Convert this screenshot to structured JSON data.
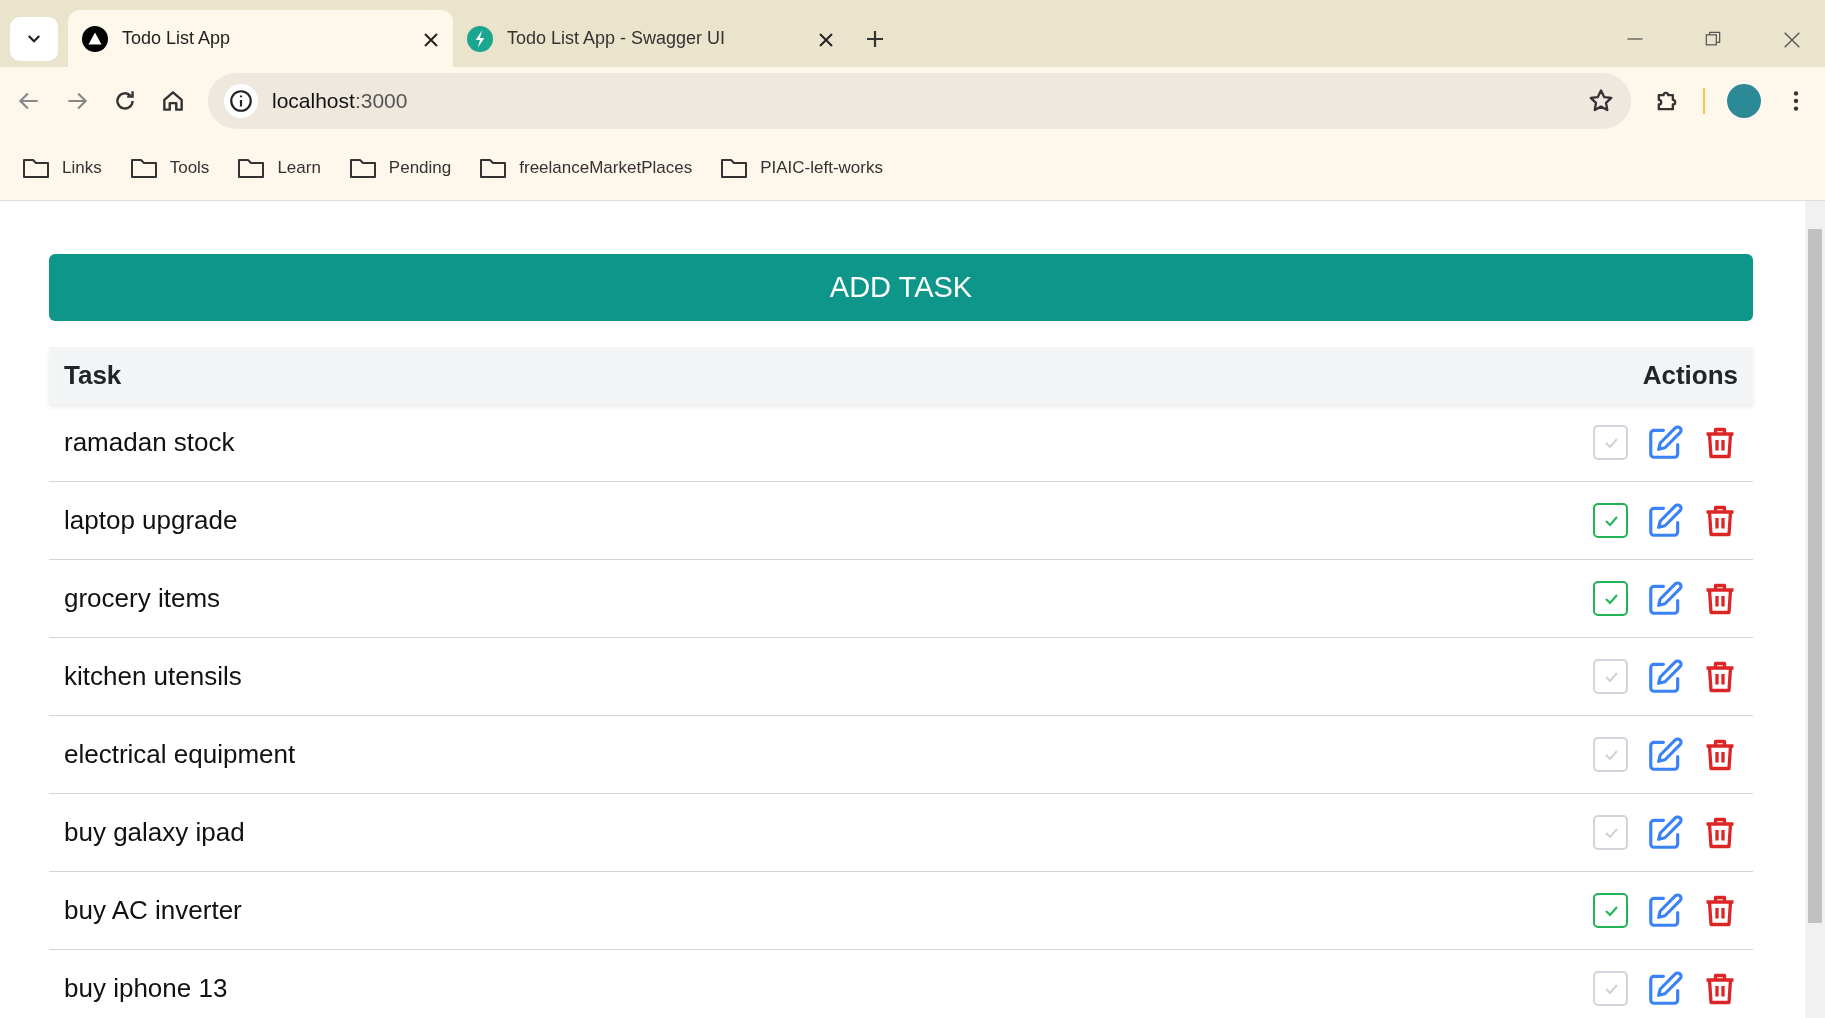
{
  "browser": {
    "tabs": [
      {
        "title": "Todo List App",
        "kind": "app",
        "selected": true
      },
      {
        "title": "Todo List App - Swagger UI",
        "kind": "swagger",
        "selected": false
      }
    ],
    "address": {
      "host": "localhost",
      "port": ":3000"
    },
    "bookmarks": [
      "Links",
      "Tools",
      "Learn",
      "Pending",
      "freelanceMarketPlaces",
      "PIAIC-left-works"
    ]
  },
  "add_button": "ADD TASK",
  "table": {
    "columns": [
      "Task",
      "Actions"
    ],
    "rows": [
      {
        "task": "ramadan stock",
        "checked": false
      },
      {
        "task": "laptop upgrade",
        "checked": true
      },
      {
        "task": "grocery items",
        "checked": true
      },
      {
        "task": "kitchen utensils",
        "checked": false
      },
      {
        "task": "electrical equipment",
        "checked": false
      },
      {
        "task": "buy galaxy ipad",
        "checked": false
      },
      {
        "task": "buy AC inverter",
        "checked": true
      },
      {
        "task": "buy iphone 13",
        "checked": false
      }
    ]
  }
}
